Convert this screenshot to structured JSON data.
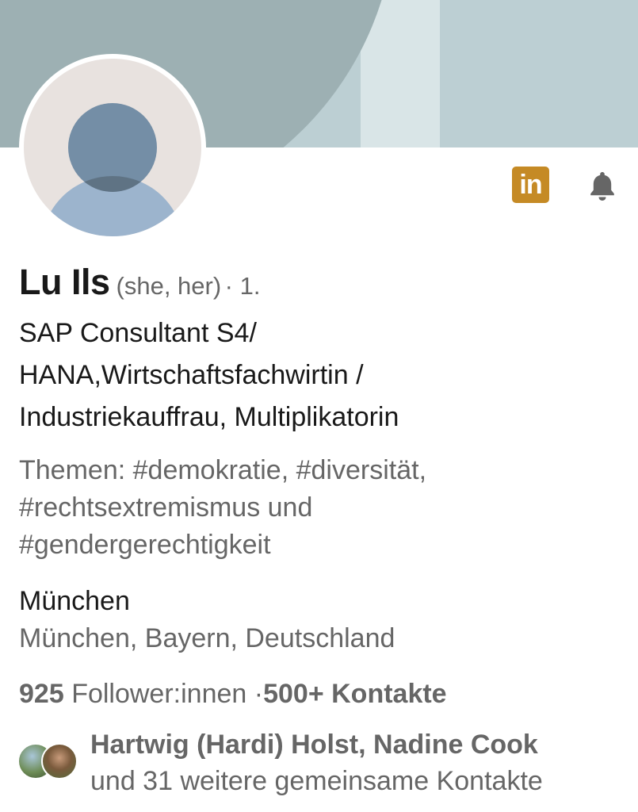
{
  "profile": {
    "name": "Lu Ils",
    "pronouns": "(she, her)",
    "connection_degree": "· 1.",
    "headline_lines": [
      "SAP Consultant S4/",
      "HANA,Wirtschaftsfachwirtin /",
      "Industriekauffrau, Multiplikatorin"
    ],
    "topics_lines": [
      "Themen: #demokratie, #diversität,",
      "#rechtsextremismus und",
      "#gendergerechtigkeit"
    ],
    "city": "München",
    "region": "München, Bayern, Deutschland"
  },
  "stats": {
    "followers_count": "925",
    "followers_label": "Follower:innen",
    "separator": " ·",
    "contacts": "500+ Kontakte"
  },
  "mutual": {
    "names": "Hartwig (Hardi) Holst, Nadine Cook",
    "rest": "und 31 weitere gemeinsame Kontakte"
  },
  "icons": {
    "linkedin_badge": "in",
    "bell": "bell-icon"
  },
  "colors": {
    "banner": "#bccfd3",
    "linkedin_badge": "#c58a25",
    "avatar_bg": "#e8e2df"
  }
}
